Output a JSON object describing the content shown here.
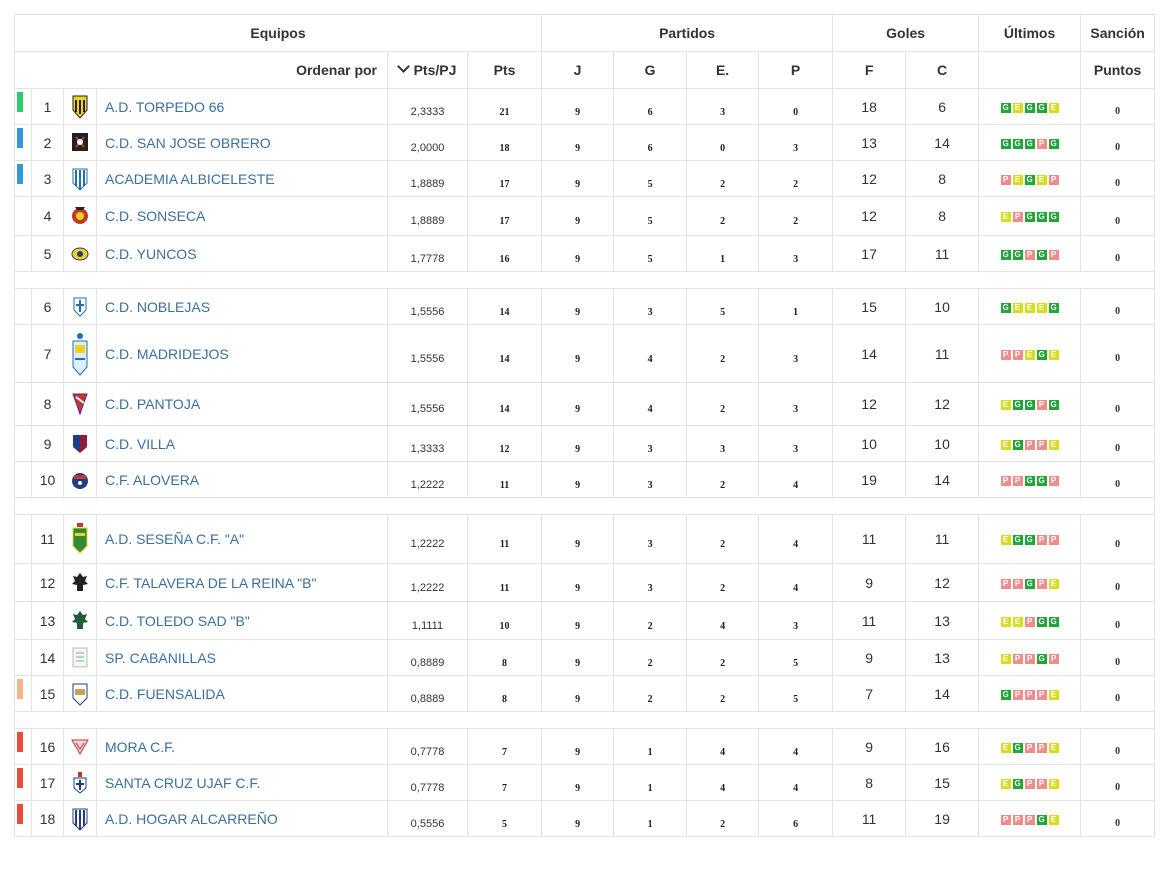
{
  "header": {
    "equipos": "Equipos",
    "partidos": "Partidos",
    "goles": "Goles",
    "ultimos": "Últimos",
    "sancion": "Sanción",
    "ordenar_por": "Ordenar por",
    "pts_pj": "Pts/PJ",
    "pts": "Pts",
    "j": "J",
    "g": "G",
    "e": "E.",
    "p": "P",
    "f": "F",
    "c": "C",
    "puntos": "Puntos"
  },
  "colors": {
    "indicator_promo": "#2ecc71",
    "indicator_playoff": "#3498db",
    "indicator_warn": "#f5b58a",
    "indicator_releg": "#e74c3c",
    "team_link": "#3a6f9e"
  },
  "teams": [
    {
      "pos": "1",
      "name": "A.D. TORPEDO 66",
      "ppj": "2,3333",
      "pts": "21",
      "j": "9",
      "g": "6",
      "e": "3",
      "p": "0",
      "f": "18",
      "c": "6",
      "last": [
        "G",
        "E",
        "G",
        "G",
        "E"
      ],
      "sancion": "0",
      "indicator": "promo",
      "crest": "torpedo"
    },
    {
      "pos": "2",
      "name": "C.D. SAN JOSE OBRERO",
      "ppj": "2,0000",
      "pts": "18",
      "j": "9",
      "g": "6",
      "e": "0",
      "p": "3",
      "f": "13",
      "c": "14",
      "last": [
        "G",
        "G",
        "G",
        "P",
        "G"
      ],
      "sancion": "0",
      "indicator": "playoff",
      "crest": "sanjose"
    },
    {
      "pos": "3",
      "name": "ACADEMIA ALBICELESTE",
      "ppj": "1,8889",
      "pts": "17",
      "j": "9",
      "g": "5",
      "e": "2",
      "p": "2",
      "f": "12",
      "c": "8",
      "last": [
        "P",
        "E",
        "G",
        "E",
        "P"
      ],
      "sancion": "0",
      "indicator": "playoff",
      "crest": "albiceleste"
    },
    {
      "pos": "4",
      "name": "C.D. SONSECA",
      "ppj": "1,8889",
      "pts": "17",
      "j": "9",
      "g": "5",
      "e": "2",
      "p": "2",
      "f": "12",
      "c": "8",
      "last": [
        "E",
        "P",
        "G",
        "G",
        "G"
      ],
      "sancion": "0",
      "indicator": "",
      "crest": "sonseca"
    },
    {
      "pos": "5",
      "name": "C.D. YUNCOS",
      "ppj": "1,7778",
      "pts": "16",
      "j": "9",
      "g": "5",
      "e": "1",
      "p": "3",
      "f": "17",
      "c": "11",
      "last": [
        "G",
        "G",
        "P",
        "G",
        "P"
      ],
      "sancion": "0",
      "indicator": "",
      "crest": "yuncos"
    },
    {
      "spacer": true
    },
    {
      "pos": "6",
      "name": "C.D. NOBLEJAS",
      "ppj": "1,5556",
      "pts": "14",
      "j": "9",
      "g": "3",
      "e": "5",
      "p": "1",
      "f": "15",
      "c": "10",
      "last": [
        "G",
        "E",
        "E",
        "E",
        "G"
      ],
      "sancion": "0",
      "indicator": "",
      "crest": "noblejas"
    },
    {
      "pos": "7",
      "name": "C.D. MADRIDEJOS",
      "ppj": "1,5556",
      "pts": "14",
      "j": "9",
      "g": "4",
      "e": "2",
      "p": "3",
      "f": "14",
      "c": "11",
      "last": [
        "P",
        "P",
        "E",
        "G",
        "E"
      ],
      "sancion": "0",
      "indicator": "",
      "crest": "madridejos",
      "tall": true
    },
    {
      "pos": "8",
      "name": "C.D. PANTOJA",
      "ppj": "1,5556",
      "pts": "14",
      "j": "9",
      "g": "4",
      "e": "2",
      "p": "3",
      "f": "12",
      "c": "12",
      "last": [
        "E",
        "G",
        "G",
        "P",
        "G"
      ],
      "sancion": "0",
      "indicator": "",
      "crest": "pantoja"
    },
    {
      "pos": "9",
      "name": "C.D. VILLA",
      "ppj": "1,3333",
      "pts": "12",
      "j": "9",
      "g": "3",
      "e": "3",
      "p": "3",
      "f": "10",
      "c": "10",
      "last": [
        "E",
        "G",
        "P",
        "P",
        "E"
      ],
      "sancion": "0",
      "indicator": "",
      "crest": "villa"
    },
    {
      "pos": "10",
      "name": "C.F. ALOVERA",
      "ppj": "1,2222",
      "pts": "11",
      "j": "9",
      "g": "3",
      "e": "2",
      "p": "4",
      "f": "19",
      "c": "14",
      "last": [
        "P",
        "P",
        "G",
        "G",
        "P"
      ],
      "sancion": "0",
      "indicator": "",
      "crest": "alovera"
    },
    {
      "spacer": true
    },
    {
      "pos": "11",
      "name": "A.D. SESEÑA C.F. \"A\"",
      "ppj": "1,2222",
      "pts": "11",
      "j": "9",
      "g": "3",
      "e": "2",
      "p": "4",
      "f": "11",
      "c": "11",
      "last": [
        "E",
        "G",
        "G",
        "P",
        "P"
      ],
      "sancion": "0",
      "indicator": "",
      "crest": "sesena",
      "tall2": true
    },
    {
      "pos": "12",
      "name": "C.F. TALAVERA DE LA REINA \"B\"",
      "ppj": "1,2222",
      "pts": "11",
      "j": "9",
      "g": "3",
      "e": "2",
      "p": "4",
      "f": "9",
      "c": "12",
      "last": [
        "P",
        "P",
        "G",
        "P",
        "E"
      ],
      "sancion": "0",
      "indicator": "",
      "crest": "talavera"
    },
    {
      "pos": "13",
      "name": "C.D. TOLEDO SAD \"B\"",
      "ppj": "1,1111",
      "pts": "10",
      "j": "9",
      "g": "2",
      "e": "4",
      "p": "3",
      "f": "11",
      "c": "13",
      "last": [
        "E",
        "E",
        "P",
        "G",
        "G"
      ],
      "sancion": "0",
      "indicator": "",
      "crest": "toledo"
    },
    {
      "pos": "14",
      "name": "SP. CABANILLAS",
      "ppj": "0,8889",
      "pts": "8",
      "j": "9",
      "g": "2",
      "e": "2",
      "p": "5",
      "f": "9",
      "c": "13",
      "last": [
        "E",
        "P",
        "P",
        "G",
        "P"
      ],
      "sancion": "0",
      "indicator": "",
      "crest": "cabanillas"
    },
    {
      "pos": "15",
      "name": "C.D. FUENSALIDA",
      "ppj": "0,8889",
      "pts": "8",
      "j": "9",
      "g": "2",
      "e": "2",
      "p": "5",
      "f": "7",
      "c": "14",
      "last": [
        "G",
        "P",
        "P",
        "P",
        "E"
      ],
      "sancion": "0",
      "indicator": "warn",
      "crest": "fuensalida"
    },
    {
      "spacer": true
    },
    {
      "pos": "16",
      "name": "MORA C.F.",
      "ppj": "0,7778",
      "pts": "7",
      "j": "9",
      "g": "1",
      "e": "4",
      "p": "4",
      "f": "9",
      "c": "16",
      "last": [
        "E",
        "G",
        "P",
        "P",
        "E"
      ],
      "sancion": "0",
      "indicator": "releg",
      "crest": "mora"
    },
    {
      "pos": "17",
      "name": "SANTA CRUZ UJAF C.F.",
      "ppj": "0,7778",
      "pts": "7",
      "j": "9",
      "g": "1",
      "e": "4",
      "p": "4",
      "f": "8",
      "c": "15",
      "last": [
        "E",
        "G",
        "P",
        "P",
        "E"
      ],
      "sancion": "0",
      "indicator": "releg",
      "crest": "santacruz"
    },
    {
      "pos": "18",
      "name": "A.D. HOGAR ALCARREÑO",
      "ppj": "0,5556",
      "pts": "5",
      "j": "9",
      "g": "1",
      "e": "2",
      "p": "6",
      "f": "11",
      "c": "19",
      "last": [
        "P",
        "P",
        "P",
        "G",
        "E"
      ],
      "sancion": "0",
      "indicator": "releg",
      "crest": "hogar"
    }
  ]
}
